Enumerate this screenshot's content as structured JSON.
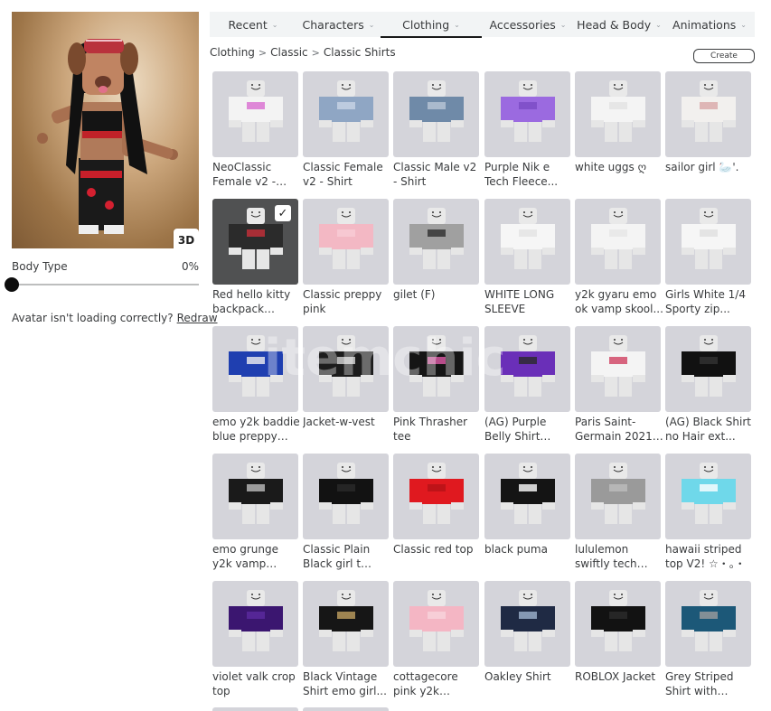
{
  "avatar": {
    "view_toggle_label": "3D",
    "body_type_label": "Body Type",
    "body_type_value": "0%",
    "body_type_fraction": 0,
    "loading_text": "Avatar isn't loading correctly?",
    "redraw_label": "Redraw"
  },
  "tabs": [
    {
      "label": "Recent",
      "active": false
    },
    {
      "label": "Characters",
      "active": false
    },
    {
      "label": "Clothing",
      "active": true
    },
    {
      "label": "Accessories",
      "active": false
    },
    {
      "label": "Head & Body",
      "active": false
    },
    {
      "label": "Animations",
      "active": false
    }
  ],
  "breadcrumb": [
    "Clothing",
    "Classic",
    "Classic Shirts"
  ],
  "create_label": "Create",
  "items": [
    {
      "name": "NeoClassic Female v2 - Shirt",
      "color": "#f3f3f3",
      "accent": "#d86bd0",
      "selected": false
    },
    {
      "name": "Classic Female v2 - Shirt",
      "color": "#8fa6c4",
      "accent": "#c8d4e6",
      "selected": false
    },
    {
      "name": "Classic Male v2 - Shirt",
      "color": "#6f8aa8",
      "accent": "#b9c6d6",
      "selected": false
    },
    {
      "name": "Purple Nik e Tech Fleece...",
      "color": "#9b6ae0",
      "accent": "#7a4bc4",
      "selected": false
    },
    {
      "name": "white uggs ღ",
      "color": "#f4f4f4",
      "accent": "#e2e2e2",
      "selected": false
    },
    {
      "name": "sailor girl 🦢'.",
      "color": "#f2f0ee",
      "accent": "#d8a8a8",
      "selected": false
    },
    {
      "name": "Red hello kitty backpack crop...",
      "color": "#2b2b2b",
      "accent": "#c8303a",
      "selected": true
    },
    {
      "name": "Classic preppy pink",
      "color": "#f3b8c4",
      "accent": "#f7ccd6",
      "selected": false
    },
    {
      "name": "gilet (F)",
      "color": "#a0a0a0",
      "accent": "#2e2e2e",
      "selected": false
    },
    {
      "name": "WHITE LONG SLEEVE",
      "color": "#f6f6f6",
      "accent": "#e4e4e4",
      "selected": false
    },
    {
      "name": "y2k gyaru emo ok vamp skool...",
      "color": "#f4f4f4",
      "accent": "#e6e6e6",
      "selected": false
    },
    {
      "name": "Girls White 1/4 Sporty zip...",
      "color": "#f6f6f6",
      "accent": "#e0e0e0",
      "selected": false
    },
    {
      "name": "emo y2k baddie blue preppy dh...",
      "color": "#1f3fb0",
      "accent": "#f0f0f0",
      "selected": false
    },
    {
      "name": "Jacket-w-vest",
      "color": "#1c1c1c",
      "accent": "#d8d8d8",
      "selected": false
    },
    {
      "name": "Pink Thrasher tee",
      "color": "#151515",
      "accent": "#e05aa8",
      "selected": false
    },
    {
      "name": "(AG) Purple Belly Shirt (Violet...",
      "color": "#6a2fb8",
      "accent": "#2a2a2a",
      "selected": false
    },
    {
      "name": "Paris Saint-Germain 2021-2...",
      "color": "#f4f4f4",
      "accent": "#d04060",
      "selected": false
    },
    {
      "name": "(AG) Black Shirt no Hair ext...",
      "color": "#111111",
      "accent": "#333333",
      "selected": false
    },
    {
      "name": "emo grunge y2k vamp baddie...",
      "color": "#1a1a1a",
      "accent": "#bdbdbd",
      "selected": false
    },
    {
      "name": "Classic Plain Black girl t Clot...",
      "color": "#121212",
      "accent": "#2a2a2a",
      "selected": false
    },
    {
      "name": "Classic red top",
      "color": "#e0191f",
      "accent": "#b51217",
      "selected": false
    },
    {
      "name": "black puma",
      "color": "#141414",
      "accent": "#ffffff",
      "selected": false
    },
    {
      "name": "lululemon swiftly tech shirt",
      "color": "#9a9a9a",
      "accent": "#bdbdbd",
      "selected": false
    },
    {
      "name": "hawaii striped top V2! ☆・。・",
      "color": "#6fd8ea",
      "accent": "#ffffff",
      "selected": false
    },
    {
      "name": "violet valk crop top",
      "color": "#3b1670",
      "accent": "#5c2aa0",
      "selected": false
    },
    {
      "name": "Black Vintage Shirt emo girl...",
      "color": "#161616",
      "accent": "#c0a060",
      "selected": false
    },
    {
      "name": "cottagecore pink y2k vintag...",
      "color": "#f4b6c4",
      "accent": "#f8d4dc",
      "selected": false
    },
    {
      "name": "Oakley Shirt",
      "color": "#1f2a44",
      "accent": "#9fb4d0",
      "selected": false
    },
    {
      "name": "ROBLOX Jacket",
      "color": "#121212",
      "accent": "#2c2c2c",
      "selected": false
    },
    {
      "name": "Grey Striped Shirt with Deni...",
      "color": "#1c5878",
      "accent": "#9e9e9e",
      "selected": false
    }
  ]
}
